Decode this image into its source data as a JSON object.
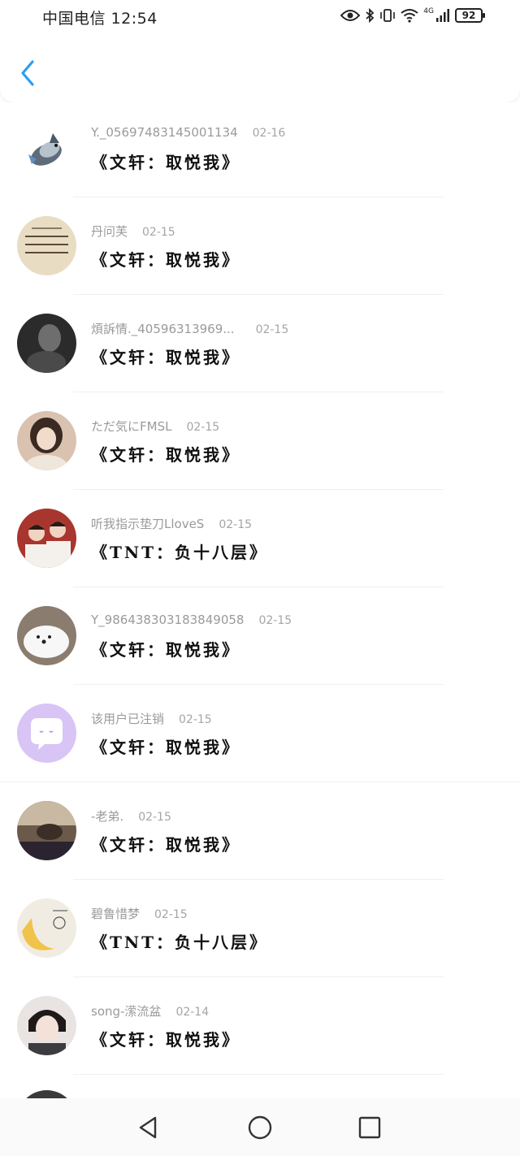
{
  "status_bar": {
    "left_text": "中国电信 12:54",
    "network": "4G",
    "battery": "92"
  },
  "colors": {
    "accent": "#2a9df4"
  },
  "items": [
    {
      "name": "Y._0569748314500113​4",
      "date": "02-16",
      "title": "《文轩：取悦我》",
      "avatar": "shark-plush"
    },
    {
      "name": "丹问芙",
      "date": "02-15",
      "title": "《文轩：取悦我》",
      "avatar": "calligraphy"
    },
    {
      "name": "煩訴情._40596313969...",
      "date": "02-15",
      "title": "《文轩：取悦我》",
      "avatar": "dark-portrait"
    },
    {
      "name": "ただ気にFMSL",
      "date": "02-15",
      "title": "《文轩：取悦我》",
      "avatar": "girl-portrait"
    },
    {
      "name": "听我指示垫刀LloveS",
      "date": "02-15",
      "title": "《TNT：负十八层》",
      "avatar": "two-boys"
    },
    {
      "name": "Y_986438303183849058",
      "date": "02-15",
      "title": "《文轩：取悦我》",
      "avatar": "white-dog"
    },
    {
      "name": "该用户已注销",
      "date": "02-15",
      "title": "《文轩：取悦我》",
      "avatar": "deleted-user"
    },
    {
      "name": "-老弟.",
      "date": "02-15",
      "title": "《文轩：取悦我》",
      "avatar": "sleeping"
    },
    {
      "name": "碧鲁惜梦",
      "date": "02-15",
      "title": "《TNT：负十八层》",
      "avatar": "banana"
    },
    {
      "name": "song-潆流盆",
      "date": "02-14",
      "title": "《文轩：取悦我》",
      "avatar": "boy-portrait"
    }
  ]
}
